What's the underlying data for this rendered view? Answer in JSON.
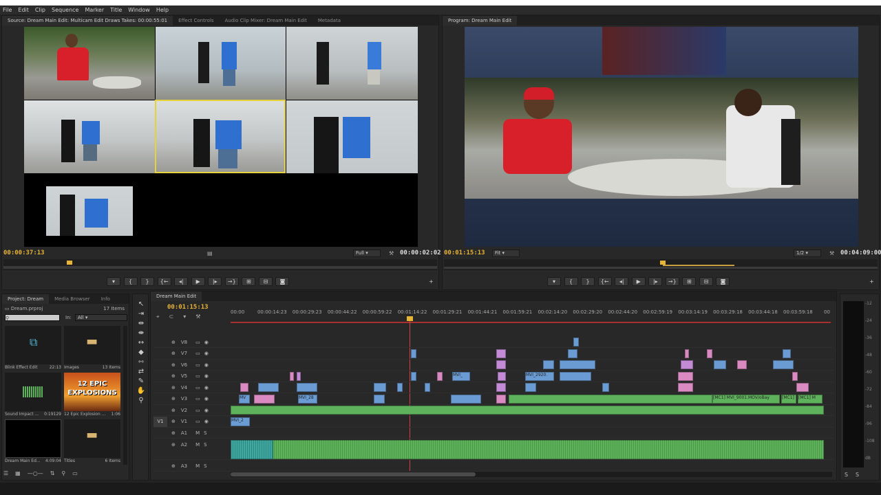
{
  "menu": [
    "File",
    "Edit",
    "Clip",
    "Sequence",
    "Marker",
    "Title",
    "Window",
    "Help"
  ],
  "source": {
    "tabs": [
      "Source: Dream Main Edit: Multicam Edit Draws Takes: 00:00:55:01",
      "Effect Controls",
      "Audio Clip Mixer: Dream Main Edit",
      "Metadata"
    ],
    "tc_in": "00:00:37:13",
    "zoom": "Full",
    "tc_out": "00:00:02:02"
  },
  "program": {
    "tab": "Program: Dream Main Edit",
    "tc_in": "00:01:15:13",
    "zoom": "Fit",
    "res": "1/2",
    "tc_out": "00:04:09:00"
  },
  "project": {
    "tabs": [
      "Project: Dream",
      "Media Browser",
      "Info"
    ],
    "file": "Dream.prproj",
    "count": "17 Items",
    "in_label": "In:",
    "in_value": "All",
    "items": [
      {
        "name": "Blink Effect Edit",
        "meta": "22:13"
      },
      {
        "name": "Images",
        "meta": "13 Items"
      },
      {
        "name": "Sound Impact ...",
        "meta": "0:19129"
      },
      {
        "name": "12 Epic Explosion ...",
        "meta": "1:06"
      },
      {
        "name": "Dream Main Ed...",
        "meta": "4:09:04"
      },
      {
        "name": "Titles",
        "meta": "6 Items"
      }
    ],
    "epic_line1": "12 EPIC",
    "epic_line2": "EXPLOSIONS"
  },
  "timeline": {
    "tab": "Dream Main Edit",
    "tc": "00:01:15:13",
    "ruler": [
      "00:00",
      "00:00:14:23",
      "00:00:29:23",
      "00:00:44:22",
      "00:00:59:22",
      "00:01:14:22",
      "00:01:29:21",
      "00:01:44:21",
      "00:01:59:21",
      "00:02:14:20",
      "00:02:29:20",
      "00:02:44:20",
      "00:02:59:19",
      "00:03:14:19",
      "00:03:29:18",
      "00:03:44:18",
      "00:03:59:18",
      "00"
    ],
    "video_tracks": [
      "V8",
      "V7",
      "V6",
      "V5",
      "V4",
      "V3",
      "V2",
      "V1"
    ],
    "audio_tracks": [
      "A1",
      "A2",
      "A3"
    ],
    "src_patch": "V1",
    "clip_labels": {
      "v3a": "MVI_28",
      "v3b": "[MC1] MVI_9001.MOV/oBay",
      "v3c": "[MC1]",
      "v3d": "[MC1] M",
      "v5a": "MVI_",
      "v5b": "MVI_2920.",
      "v1a": "MVI_2"
    }
  },
  "meter": {
    "labels": [
      "-12",
      "-24",
      "-36",
      "-48",
      "-60",
      "-72",
      "-84",
      "-96",
      "-108",
      "dB"
    ]
  }
}
